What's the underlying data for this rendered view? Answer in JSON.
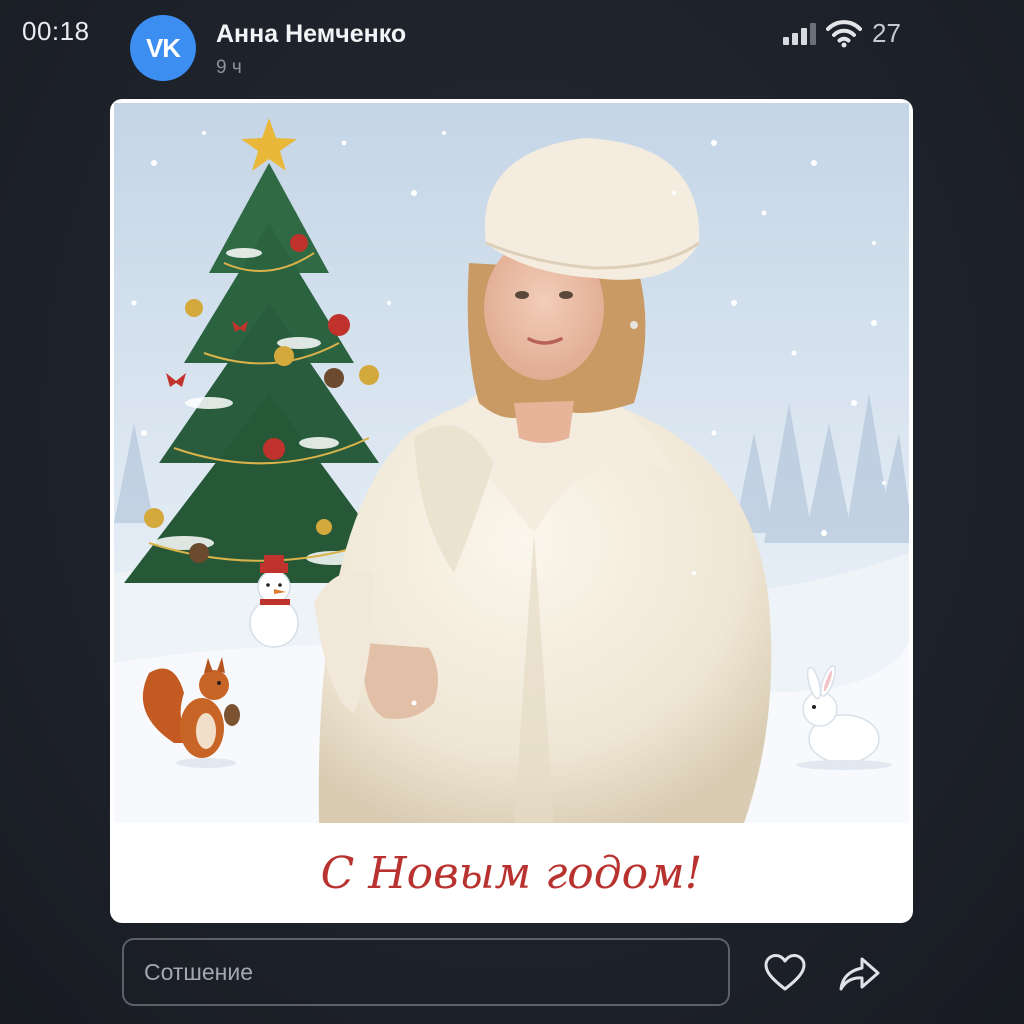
{
  "status_bar": {
    "time": "00:18",
    "battery": "27",
    "signal_icon": "cellular-signal-icon",
    "wifi_icon": "wifi-icon"
  },
  "post": {
    "avatar_text": "VK",
    "author_name": "Анна Немченко",
    "time_ago": "9 ч",
    "image_caption": "С Новым годом!"
  },
  "composer": {
    "placeholder": "Сотшение",
    "like_icon": "heart-icon",
    "share_icon": "share-arrow-icon"
  },
  "colors": {
    "background": "#1f232b",
    "avatar": "#3c8ef0",
    "caption": "#b8322f"
  }
}
